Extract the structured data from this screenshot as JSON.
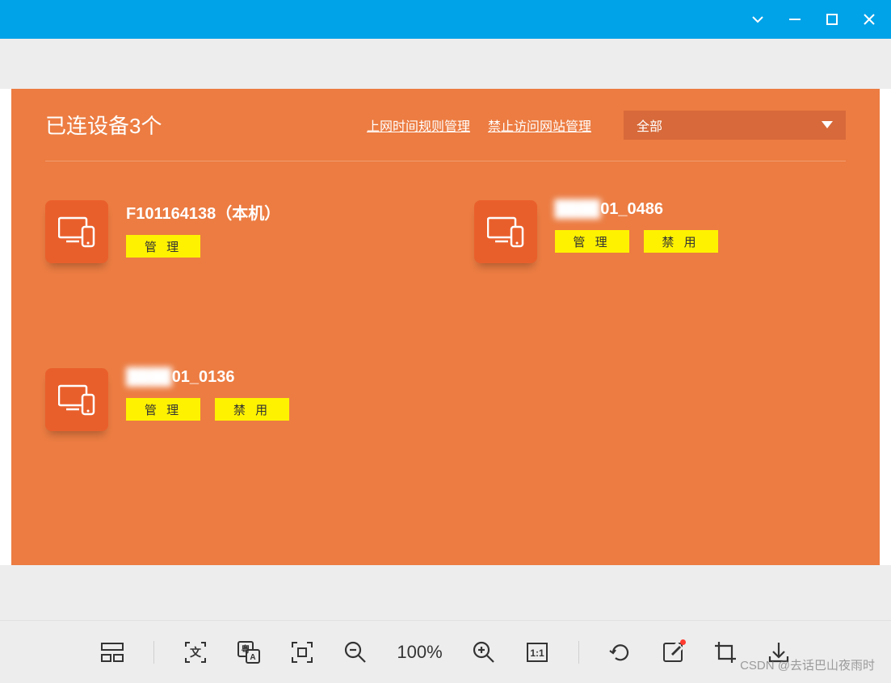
{
  "titlebar": {
    "buttons": [
      "dropdown",
      "minimize",
      "maximize",
      "close"
    ]
  },
  "panel": {
    "title": "已连设备3个",
    "link_time": "上网时间规则管理",
    "link_site": "禁止访问网站管理",
    "filter_selected": "全部"
  },
  "devices": [
    {
      "name_prefix": "",
      "name": "F101164138（本机）",
      "manage": "管 理",
      "disable": null
    },
    {
      "name_prefix": "████",
      "name": "01_0486",
      "manage": "管 理",
      "disable": "禁 用"
    },
    {
      "name_prefix": "████",
      "name": "01_0136",
      "manage": "管 理",
      "disable": "禁 用"
    }
  ],
  "toolbar": {
    "zoom": "100%"
  },
  "watermark": "CSDN @去话巴山夜雨时"
}
